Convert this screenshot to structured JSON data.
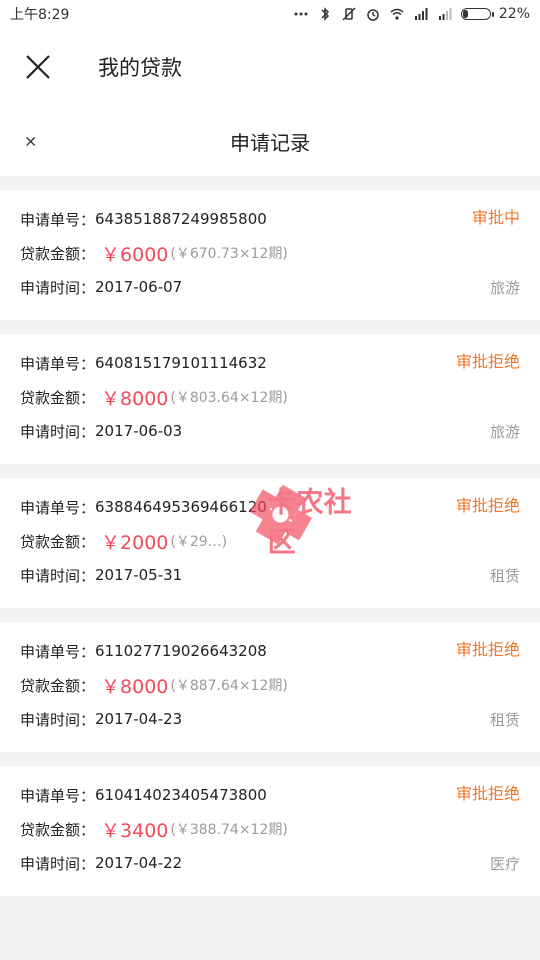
{
  "status_bar": {
    "time": "上午8:29",
    "battery_percent": "22%",
    "battery_level": 0.22
  },
  "app_bar": {
    "title": "我的贷款"
  },
  "sub_header": {
    "close_label": "×",
    "title": "申请记录"
  },
  "labels": {
    "order_no": "申请单号：",
    "amount": "贷款金额：",
    "time": "申请时间："
  },
  "records": [
    {
      "order_no": "643851887249985800",
      "amount": "￥6000",
      "breakdown": "(￥670.73×12期)",
      "time": "2017-06-07",
      "status": "审批中",
      "category": "旅游"
    },
    {
      "order_no": "640815179101114632",
      "amount": "￥8000",
      "breakdown": "(￥803.64×12期)",
      "time": "2017-06-03",
      "status": "审批拒绝",
      "category": "旅游"
    },
    {
      "order_no": "638846495369466120",
      "amount": "￥2000",
      "breakdown": "(￥29…)",
      "time": "2017-05-31",
      "status": "审批拒绝",
      "category": "租赁"
    },
    {
      "order_no": "611027719026643208",
      "amount": "￥8000",
      "breakdown": "(￥887.64×12期)",
      "time": "2017-04-23",
      "status": "审批拒绝",
      "category": "租赁"
    },
    {
      "order_no": "610414023405473800",
      "amount": "￥3400",
      "breakdown": "(￥388.74×12期)",
      "time": "2017-04-22",
      "status": "审批拒绝",
      "category": "医疗"
    }
  ],
  "watermark": {
    "text": "卡农社区"
  },
  "colors": {
    "accent": "#f24a5d",
    "status": "#f3782a",
    "muted": "#9b9b9b"
  }
}
